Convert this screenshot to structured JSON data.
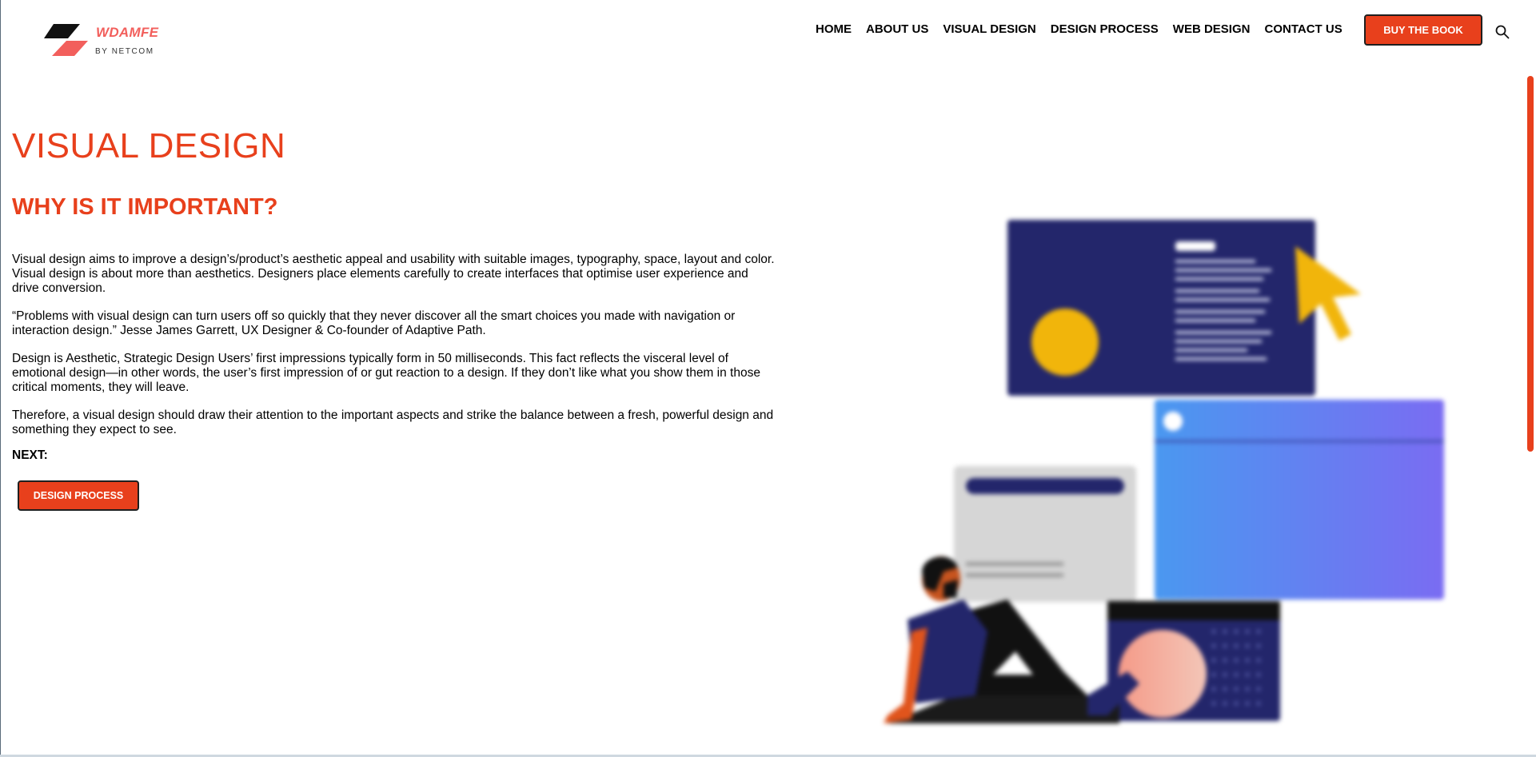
{
  "header": {
    "brand": "WDAMFE",
    "brand_sub": "BY NETCOM",
    "nav": [
      "HOME",
      "ABOUT US",
      "VISUAL DESIGN",
      "DESIGN PROCESS",
      "WEB DESIGN",
      "CONTACT US"
    ],
    "buy_button": "BUY THE BOOK"
  },
  "main": {
    "title": "VISUAL DESIGN",
    "subtitle": "WHY IS IT IMPORTANT?",
    "paragraphs": [
      "Visual design aims to improve a design’s/product’s aesthetic appeal and usability with suitable images, typography, space, layout and color. Visual design is about more than aesthetics. Designers place elements carefully to create interfaces that optimise user experience and drive conversion.",
      "“Problems with visual design can turn users off so quickly that they never discover all the smart choices you made with navigation or interaction design.” Jesse James Garrett, UX Designer & Co-founder of Adaptive Path.",
      "Design is Aesthetic, Strategic Design Users’ first impressions typically form in 50 milliseconds. This fact reflects the visceral level of emotional design—in other words, the user’s first impression of or gut reaction to a design. If they don’t like what you show them in those critical moments, they will leave.",
      "Therefore, a visual design should draw their attention to the important aspects and strike the balance between a fresh, powerful design and something they expect to see."
    ],
    "next_label": "NEXT:",
    "next_button": "DESIGN PROCESS"
  },
  "colors": {
    "accent": "#e8401c",
    "brand": "#f25f5c",
    "navy": "#23266b",
    "yellow": "#f1b50b"
  },
  "icons": {
    "search": "search-icon",
    "logo": "logo-icon"
  }
}
